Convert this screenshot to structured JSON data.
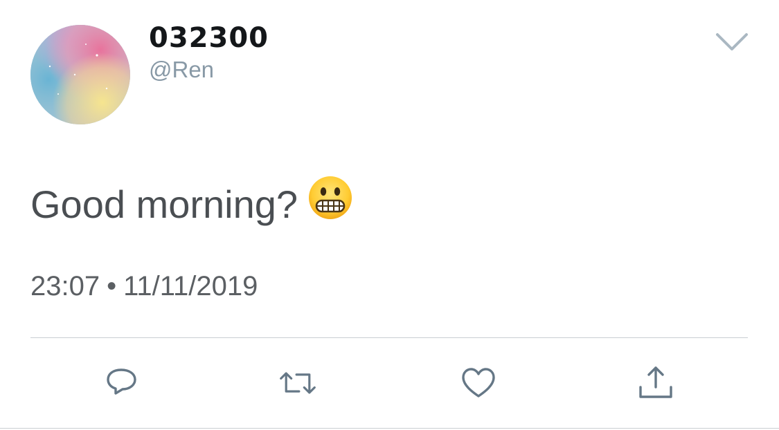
{
  "user": {
    "display_name": "032300",
    "handle": "@Ren",
    "avatar_icon": "pastel-galaxy-avatar"
  },
  "tweet": {
    "text": "Good morning?",
    "emoji_icon": "grimacing-face-emoji",
    "time": "23:07",
    "separator": "•",
    "date": "11/11/2019"
  },
  "header": {
    "menu_icon": "chevron-down-icon"
  },
  "actions": [
    {
      "name": "reply",
      "icon": "reply-icon"
    },
    {
      "name": "retweet",
      "icon": "retweet-icon"
    },
    {
      "name": "like",
      "icon": "heart-icon"
    },
    {
      "name": "share",
      "icon": "share-icon"
    }
  ],
  "colors": {
    "text_primary": "#14171a",
    "text_secondary": "#8899a6",
    "tweet_text": "#4a4e52",
    "icon_gray": "#657786",
    "divider": "#c9ced2"
  }
}
